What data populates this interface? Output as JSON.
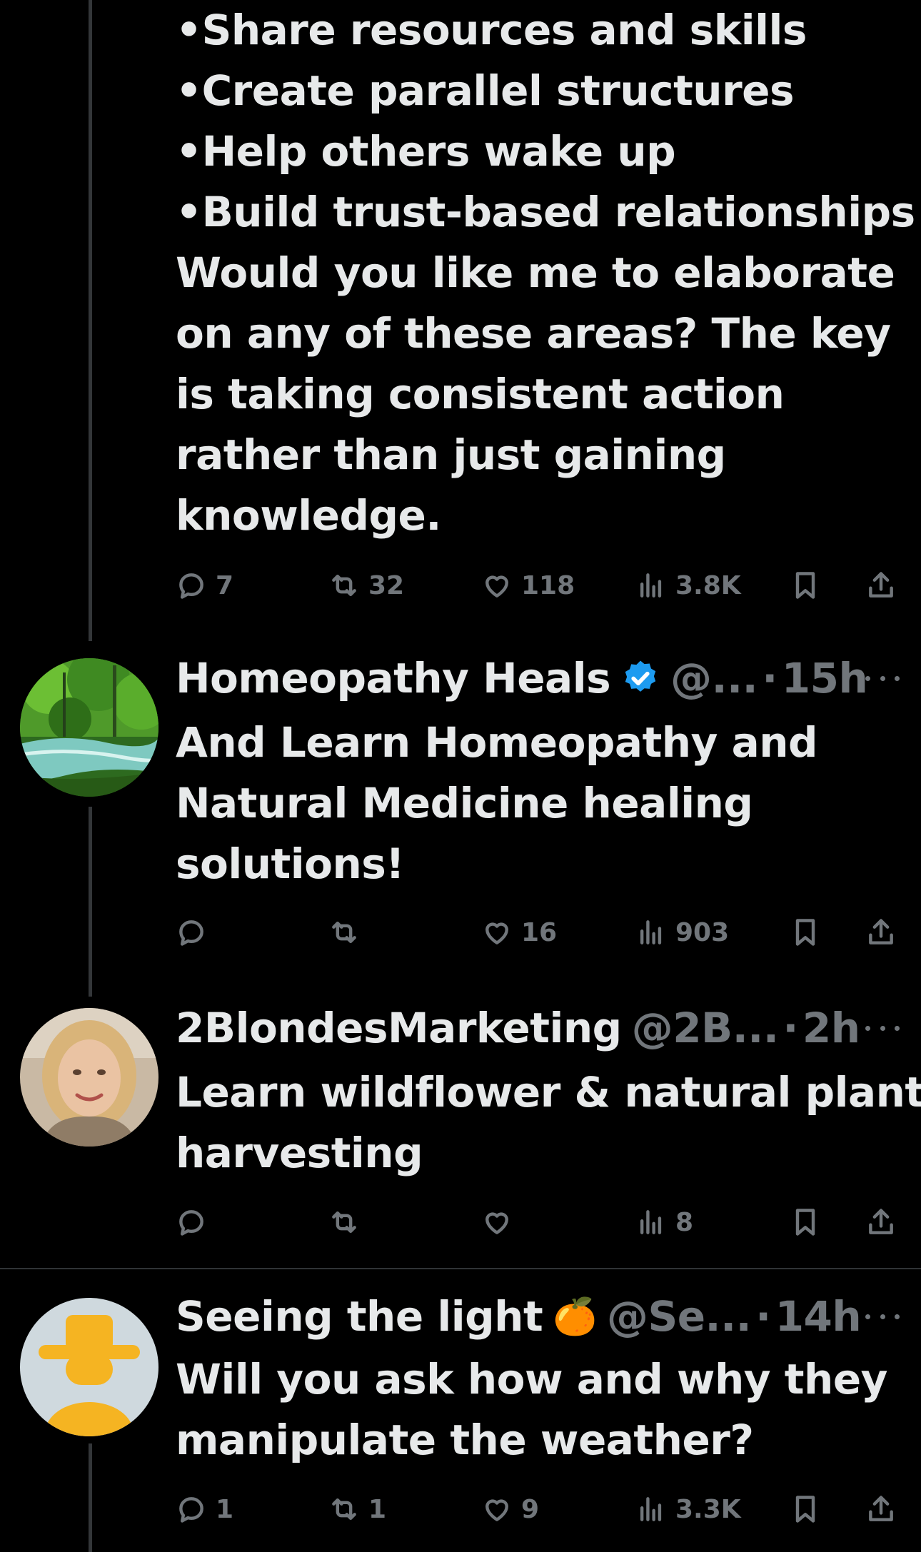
{
  "top_post": {
    "lines": [
      "•Share resources and skills",
      "•Create parallel structures",
      "•Help others wake up",
      "•Build trust-based relationships",
      "Would you like me to elaborate",
      "on any of these areas? The key",
      "is taking consistent action",
      "rather than just gaining",
      "knowledge."
    ],
    "replies": "7",
    "reposts": "32",
    "likes": "118",
    "views": "3.8K"
  },
  "posts": [
    {
      "name": "Homeopathy Heals",
      "verified": true,
      "handle": "@...",
      "time": "15h",
      "lines": [
        "And Learn Homeopathy and",
        "Natural Medicine healing",
        "solutions!"
      ],
      "replies": "",
      "reposts": "",
      "likes": "16",
      "views": "903"
    },
    {
      "name": "2BlondesMarketing",
      "verified": false,
      "handle": "@2B...",
      "time": "2h",
      "lines": [
        "Learn wildflower & natural plant",
        "harvesting"
      ],
      "replies": "",
      "reposts": "",
      "likes": "",
      "views": "8"
    },
    {
      "name": "Seeing the light",
      "emoji": "🍊",
      "handle": "@Se...",
      "time": "14h",
      "lines": [
        "Will you ask how and why they",
        "manipulate the weather?"
      ],
      "replies": "1",
      "reposts": "1",
      "likes": "9",
      "views": "3.3K"
    }
  ],
  "separator": "·",
  "colors": {
    "background": "#000000",
    "text": "#e7e9ea",
    "muted": "#71767b",
    "verified": "#1d9bf0"
  }
}
